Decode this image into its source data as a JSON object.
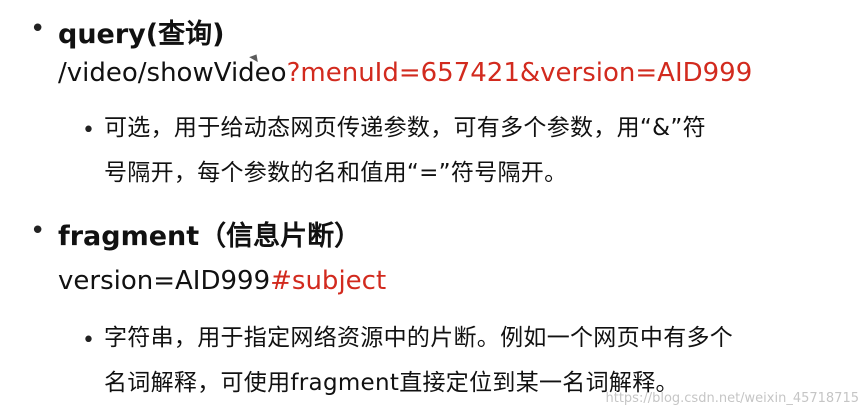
{
  "section_query": {
    "heading": "query(查询)",
    "example_path": "/video/showVideo",
    "example_query": "?menuId=657421&version=AID999",
    "description_lines": [
      "可选，用于给动态网页传递参数，可有多个参数，用“&”符",
      "号隔开，每个参数的名和值用“=”符号隔开。"
    ]
  },
  "section_fragment": {
    "heading": "fragment（信息片断）",
    "example_value": "version=AID999",
    "example_fragment": "#subject",
    "description_lines": [
      "字符串，用于指定网络资源中的片断。例如一个网页中有多个",
      "名词解释，可使用fragment直接定位到某一名词解释。"
    ]
  },
  "bullet_glyph": "•",
  "watermark": "https://blog.csdn.net/weixin_45718715",
  "colors": {
    "highlight": "#d22a1e",
    "text": "#111111"
  }
}
